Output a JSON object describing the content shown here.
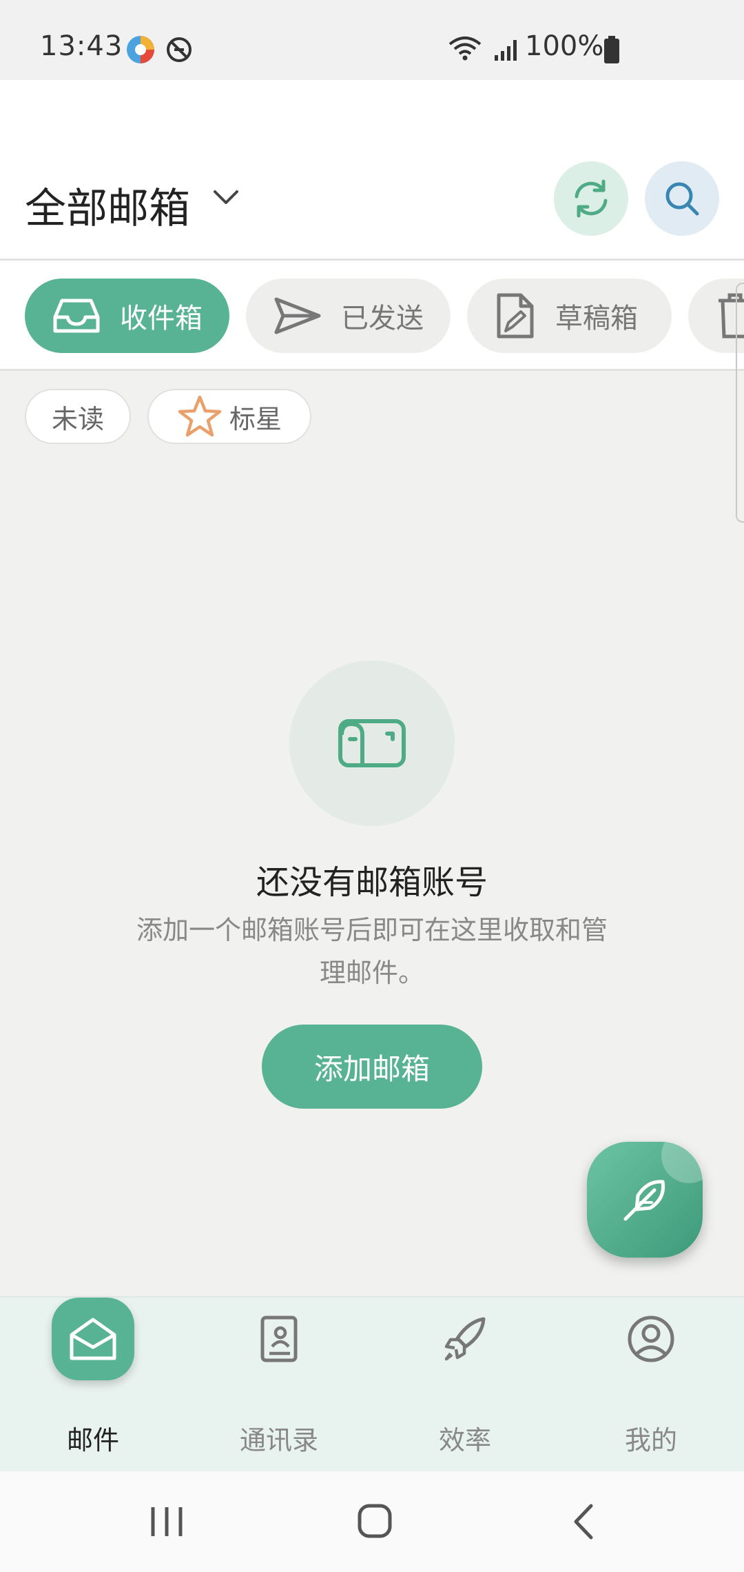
{
  "status_bar": {
    "time": "13:43",
    "battery": "100%",
    "icons": [
      "app-notification-icon",
      "no-disturb-icon",
      "wifi-icon",
      "signal-icon",
      "battery-icon"
    ]
  },
  "header": {
    "title": "全部邮箱",
    "refresh_icon": "refresh-icon",
    "search_icon": "search-icon"
  },
  "tabs": [
    {
      "label": "收件箱",
      "icon": "inbox-icon",
      "active": true
    },
    {
      "label": "已发送",
      "icon": "send-icon",
      "active": false
    },
    {
      "label": "草稿箱",
      "icon": "draft-icon",
      "active": false
    },
    {
      "label": "",
      "icon": "trash-icon",
      "active": false
    }
  ],
  "filters": [
    {
      "label": "未读"
    },
    {
      "label": "标星",
      "icon": "star-icon"
    }
  ],
  "empty_state": {
    "icon": "mailbox-icon",
    "title": "还没有邮箱账号",
    "description": "添加一个邮箱账号后即可在这里收取和管理邮件。",
    "button": "添加邮箱"
  },
  "fab": {
    "icon": "feather-compose-icon"
  },
  "bottom_nav": [
    {
      "label": "邮件",
      "icon": "mail-icon",
      "active": true
    },
    {
      "label": "通讯录",
      "icon": "contacts-icon",
      "active": false
    },
    {
      "label": "效率",
      "icon": "rocket-icon",
      "active": false
    },
    {
      "label": "我的",
      "icon": "profile-icon",
      "active": false
    }
  ],
  "colors": {
    "accent": "#58b394",
    "star": "#e9a06a"
  }
}
